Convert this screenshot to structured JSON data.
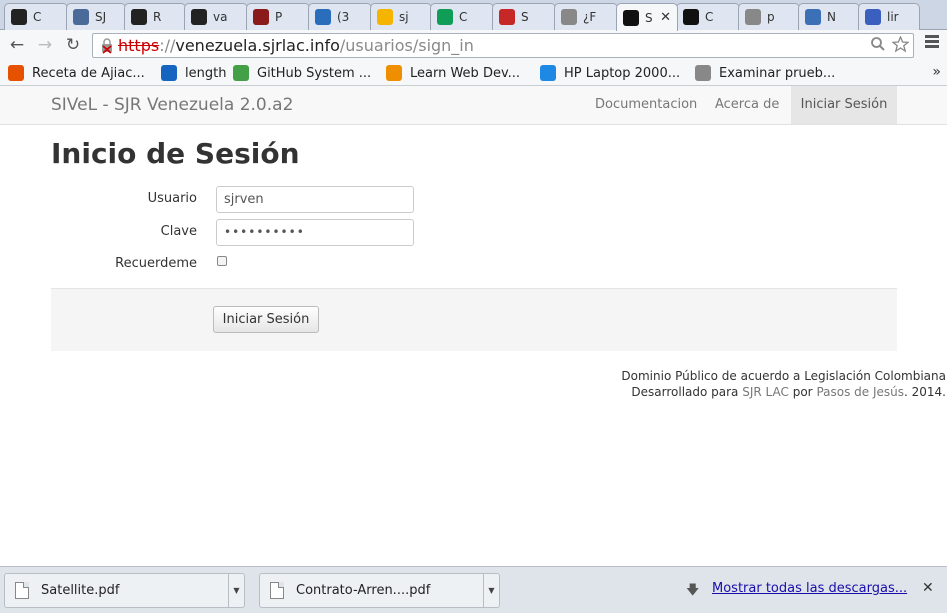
{
  "tabs": [
    {
      "label": "C",
      "icon": "github-icon",
      "color": "#222222"
    },
    {
      "label": "SJ",
      "icon": "document-icon",
      "color": "#4a6a9a"
    },
    {
      "label": "R",
      "icon": "github-icon",
      "color": "#222222"
    },
    {
      "label": "va",
      "icon": "github-icon",
      "color": "#222222"
    },
    {
      "label": "P",
      "icon": "horse-icon",
      "color": "#8b1a1a"
    },
    {
      "label": "(3",
      "icon": "globe-icon",
      "color": "#2a6ebb"
    },
    {
      "label": "sj",
      "icon": "drive-icon",
      "color": "#f4b400"
    },
    {
      "label": "C",
      "icon": "sheets-icon",
      "color": "#0f9d58"
    },
    {
      "label": "S",
      "icon": "s-logo-icon",
      "color": "#c62828"
    },
    {
      "label": "¿F",
      "icon": "page-icon",
      "color": "#888888"
    },
    {
      "label": "S",
      "icon": "sjr-icon",
      "color": "#111111",
      "active": true
    },
    {
      "label": "C",
      "icon": "sjr-icon",
      "color": "#111111"
    },
    {
      "label": "p",
      "icon": "page-icon",
      "color": "#888888"
    },
    {
      "label": "N",
      "icon": "hand-icon",
      "color": "#3b6fb6"
    },
    {
      "label": "lir",
      "icon": "letter-a-icon",
      "color": "#3b5fbf"
    }
  ],
  "address": {
    "scheme": "https",
    "separator": "://",
    "host": "venezuela.sjrlac.info",
    "path": "/usuarios/sign_in"
  },
  "bookmarks": [
    {
      "label": "Receta de Ajiac...",
      "icon": "recipe-icon",
      "color": "#e65100"
    },
    {
      "label": "length",
      "icon": "bookmark-blue-icon",
      "color": "#1565c0"
    },
    {
      "label": "GitHub System ...",
      "icon": "github-green-icon",
      "color": "#43a047"
    },
    {
      "label": "Learn Web Dev...",
      "icon": "firefox-icon",
      "color": "#ef8f00"
    },
    {
      "label": "HP Laptop 2000...",
      "icon": "info-icon",
      "color": "#1e88e5"
    },
    {
      "label": "Examinar prueb...",
      "icon": "page-icon",
      "color": "#888888"
    }
  ],
  "navbar": {
    "brand": "SIVeL - SJR Venezuela 2.0.a2",
    "links": [
      "Documentacion",
      "Acerca de",
      "Iniciar Sesión"
    ]
  },
  "form": {
    "title": "Inicio de Sesión",
    "user_label": "Usuario",
    "user_value": "sjrven",
    "password_label": "Clave",
    "password_value": "••••••••••",
    "remember_label": "Recuerdeme",
    "remember_checked": false,
    "submit_label": "Iniciar Sesión"
  },
  "footer": {
    "line1": "Dominio Público de acuerdo a Legislación Colombiana",
    "prefix": "Desarrollado para",
    "link1": "SJR LAC",
    "middle": "por",
    "link2": "Pasos de Jesús",
    "suffix": ". 2014."
  },
  "downloads": {
    "items": [
      "Satellite.pdf",
      "Contrato-Arren....pdf"
    ],
    "show_all": "Mostrar todas las descargas..."
  }
}
